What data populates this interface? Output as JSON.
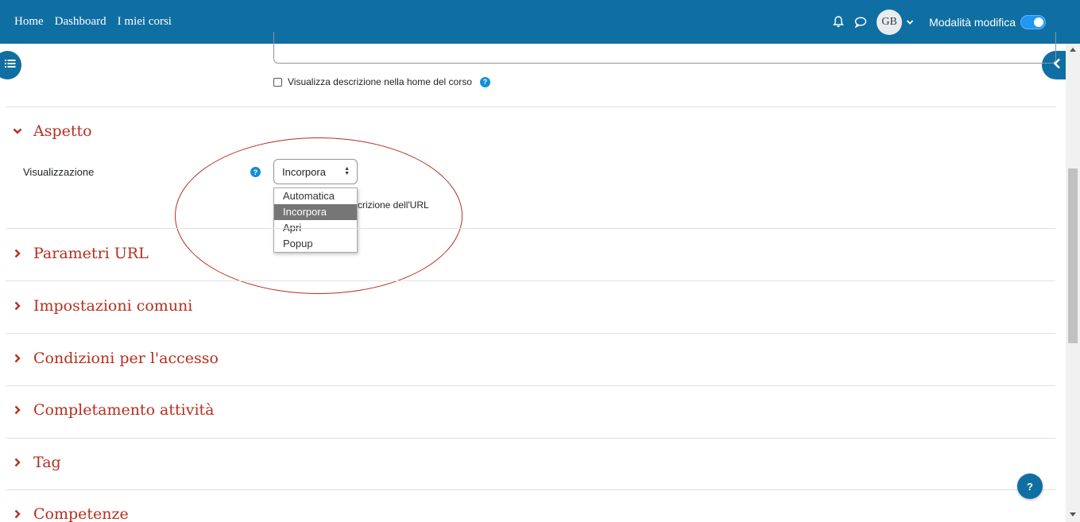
{
  "nav": {
    "links": [
      "Home",
      "Dashboard",
      "I miei corsi"
    ],
    "avatar_initials": "GB",
    "edit_mode_label": "Modalità modifica"
  },
  "description": {
    "checkbox_label": "Visualizza descrizione nella home del corso"
  },
  "sections": {
    "aspetto": "Aspetto",
    "parametri_url": "Parametri URL",
    "impostazioni_comuni": "Impostazioni comuni",
    "condizioni_accesso": "Condizioni per l'accesso",
    "completamento": "Completamento attività",
    "tag": "Tag",
    "competenze": "Competenze"
  },
  "aspetto": {
    "field_label": "Visualizzazione",
    "selected_value": "Incorpora",
    "options": [
      "Automatica",
      "Incorpora",
      "Apri",
      "Popup"
    ],
    "partial_text": "crizione dell'URL"
  },
  "help_fab": "?",
  "colors": {
    "navbar": "#0f6fa2",
    "section_title": "#b52f1f",
    "help_icon": "#0f8fd8"
  }
}
